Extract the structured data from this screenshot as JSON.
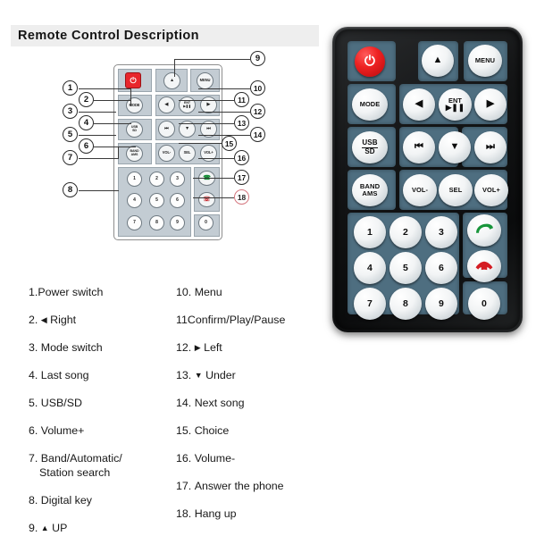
{
  "page": {
    "title": "Remote Control Description",
    "background_color": "#ffffff",
    "title_bar_color": "#eeeeee"
  },
  "colors": {
    "remote_body": "#141516",
    "keypad_panel": "#4e6e80",
    "button_face": "#f2f4f5",
    "power_red": "#ee2222",
    "answer_green": "#1a9b3c",
    "hangup_red": "#d81f26",
    "callout_outline": "#2b2b2b",
    "callout_red_outline": "#d4767e"
  },
  "remote": {
    "name": "car-stereo-ir-remote",
    "buttons": [
      {
        "id": "power",
        "label": "⏻",
        "name": "power-button",
        "type": "power"
      },
      {
        "id": "up",
        "label": "▲",
        "name": "up-button",
        "type": "glyph"
      },
      {
        "id": "menu",
        "label": "MENU",
        "name": "menu-button",
        "type": "text"
      },
      {
        "id": "mode",
        "label": "MODE",
        "name": "mode-button",
        "type": "text"
      },
      {
        "id": "left",
        "label": "◀",
        "name": "left-button",
        "type": "glyph"
      },
      {
        "id": "ent",
        "label": "ENT",
        "label2": "▶‖",
        "name": "ent-play-pause-button",
        "type": "stacked"
      },
      {
        "id": "right",
        "label": "▶",
        "name": "right-button",
        "type": "glyph"
      },
      {
        "id": "usbsd",
        "label": "USB",
        "label2": "SD",
        "name": "usb-sd-button",
        "type": "stacked"
      },
      {
        "id": "prev",
        "label": "⏮",
        "name": "previous-track-button",
        "type": "glyph"
      },
      {
        "id": "down",
        "label": "▼",
        "name": "down-button",
        "type": "glyph"
      },
      {
        "id": "next",
        "label": "⏭",
        "name": "next-track-button",
        "type": "glyph"
      },
      {
        "id": "band",
        "label": "BAND",
        "label2": "AMS",
        "name": "band-ams-button",
        "type": "stacked"
      },
      {
        "id": "volminus",
        "label": "VOL-",
        "name": "volume-down-button",
        "type": "text"
      },
      {
        "id": "sel",
        "label": "SEL",
        "name": "select-button",
        "type": "text"
      },
      {
        "id": "volplus",
        "label": "VOL+",
        "name": "volume-up-button",
        "type": "text"
      },
      {
        "id": "n1",
        "label": "1",
        "name": "digit-1-button",
        "type": "num"
      },
      {
        "id": "n2",
        "label": "2",
        "name": "digit-2-button",
        "type": "num"
      },
      {
        "id": "n3",
        "label": "3",
        "name": "digit-3-button",
        "type": "num"
      },
      {
        "id": "answer",
        "label": "",
        "name": "answer-call-button",
        "type": "phone-answer"
      },
      {
        "id": "n4",
        "label": "4",
        "name": "digit-4-button",
        "type": "num"
      },
      {
        "id": "n5",
        "label": "5",
        "name": "digit-5-button",
        "type": "num"
      },
      {
        "id": "n6",
        "label": "6",
        "name": "digit-6-button",
        "type": "num"
      },
      {
        "id": "hangup",
        "label": "",
        "name": "hangup-call-button",
        "type": "phone-hangup"
      },
      {
        "id": "n7",
        "label": "7",
        "name": "digit-7-button",
        "type": "num"
      },
      {
        "id": "n8",
        "label": "8",
        "name": "digit-8-button",
        "type": "num"
      },
      {
        "id": "n9",
        "label": "9",
        "name": "digit-9-button",
        "type": "num"
      },
      {
        "id": "n0",
        "label": "0",
        "name": "digit-0-button",
        "type": "num"
      }
    ]
  },
  "callouts": [
    {
      "n": "1",
      "red": false
    },
    {
      "n": "2",
      "red": false
    },
    {
      "n": "3",
      "red": false
    },
    {
      "n": "4",
      "red": false
    },
    {
      "n": "5",
      "red": false
    },
    {
      "n": "6",
      "red": false
    },
    {
      "n": "7",
      "red": false
    },
    {
      "n": "8",
      "red": false
    },
    {
      "n": "9",
      "red": false
    },
    {
      "n": "10",
      "red": false
    },
    {
      "n": "11",
      "red": false
    },
    {
      "n": "12",
      "red": false
    },
    {
      "n": "13",
      "red": false
    },
    {
      "n": "14",
      "red": false
    },
    {
      "n": "15",
      "red": false
    },
    {
      "n": "16",
      "red": false
    },
    {
      "n": "17",
      "red": false
    },
    {
      "n": "18",
      "red": true
    }
  ],
  "legend": {
    "left_column": [
      {
        "num": "1.",
        "text": "Power switch"
      },
      {
        "num": "2.",
        "arrow": "◀",
        "text": "Right"
      },
      {
        "num": "3.",
        "text": "Mode switch"
      },
      {
        "num": "4.",
        "text": "Last song"
      },
      {
        "num": "5.",
        "text": "USB/SD"
      },
      {
        "num": "6.",
        "text": "Volume+"
      },
      {
        "num": "7.",
        "text": "Band/Automatic/",
        "text2": "Station search"
      },
      {
        "num": "8.",
        "text": "Digital key"
      },
      {
        "num": "9.",
        "arrow": "▲",
        "text": "UP"
      }
    ],
    "right_column": [
      {
        "num": "10.",
        "text": "Menu"
      },
      {
        "num": "11",
        "text": "Confirm/Play/Pause"
      },
      {
        "num": "12.",
        "arrow": "▶",
        "text": "Left"
      },
      {
        "num": "13.",
        "arrow": "▼",
        "text": "Under"
      },
      {
        "num": "14.",
        "text": "Next song"
      },
      {
        "num": "15.",
        "text": "Choice"
      },
      {
        "num": "16.",
        "text": "Volume-"
      },
      {
        "num": "17.",
        "text": "Answer the phone"
      },
      {
        "num": "18.",
        "text": "Hang up"
      }
    ]
  },
  "schematic": {
    "name": "remote-line-drawing",
    "keys": [
      {
        "label": "⏻",
        "name": "schematic-power-key"
      },
      {
        "label": "▲",
        "name": "schematic-up-key"
      },
      {
        "label": "MENU",
        "name": "schematic-menu-key"
      },
      {
        "label": "MODE",
        "name": "schematic-mode-key"
      },
      {
        "label": "◀",
        "name": "schematic-left-key"
      },
      {
        "label": "ENT",
        "name": "schematic-ent-key"
      },
      {
        "label": "▶",
        "name": "schematic-right-key"
      },
      {
        "label": "USB SD",
        "name": "schematic-usb-sd-key"
      },
      {
        "label": "⏮",
        "name": "schematic-prev-key"
      },
      {
        "label": "▼",
        "name": "schematic-down-key"
      },
      {
        "label": "⏭",
        "name": "schematic-next-key"
      },
      {
        "label": "BAND AMS",
        "name": "schematic-band-key"
      },
      {
        "label": "VOL-",
        "name": "schematic-vol-down-key"
      },
      {
        "label": "SEL",
        "name": "schematic-sel-key"
      },
      {
        "label": "VOL+",
        "name": "schematic-vol-up-key"
      },
      {
        "label": "1",
        "name": "schematic-digit-1"
      },
      {
        "label": "2",
        "name": "schematic-digit-2"
      },
      {
        "label": "3",
        "name": "schematic-digit-3"
      },
      {
        "label": "4",
        "name": "schematic-digit-4"
      },
      {
        "label": "5",
        "name": "schematic-digit-5"
      },
      {
        "label": "6",
        "name": "schematic-digit-6"
      },
      {
        "label": "7",
        "name": "schematic-digit-7"
      },
      {
        "label": "8",
        "name": "schematic-digit-8"
      },
      {
        "label": "9",
        "name": "schematic-digit-9"
      },
      {
        "label": "0",
        "name": "schematic-digit-0"
      }
    ]
  }
}
